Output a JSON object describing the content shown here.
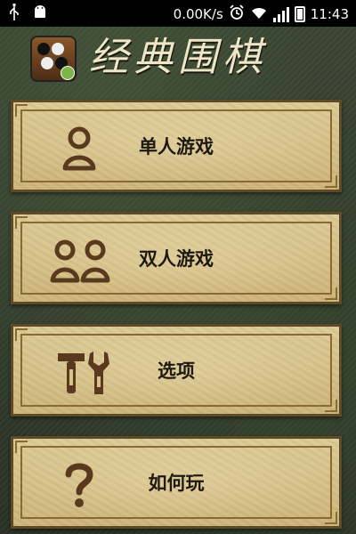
{
  "status_bar": {
    "speed": "0.00K/s",
    "time": "11:43",
    "icons": [
      "usb-icon",
      "android-icon",
      "alarm-icon",
      "wifi-icon",
      "signal-icon",
      "battery-icon"
    ]
  },
  "header": {
    "title": "经典围棋",
    "logo_icon": "go-board-icon"
  },
  "menu": [
    {
      "label": "单人游戏",
      "icon": "single-player-icon"
    },
    {
      "label": "双人游戏",
      "icon": "two-players-icon"
    },
    {
      "label": "选项",
      "icon": "tools-icon"
    },
    {
      "label": "如何玩",
      "icon": "question-icon"
    }
  ],
  "colors": {
    "card": "#d6c389",
    "icon": "#5a3a1e",
    "text": "#1e1a12",
    "title": "#efe6c8"
  }
}
